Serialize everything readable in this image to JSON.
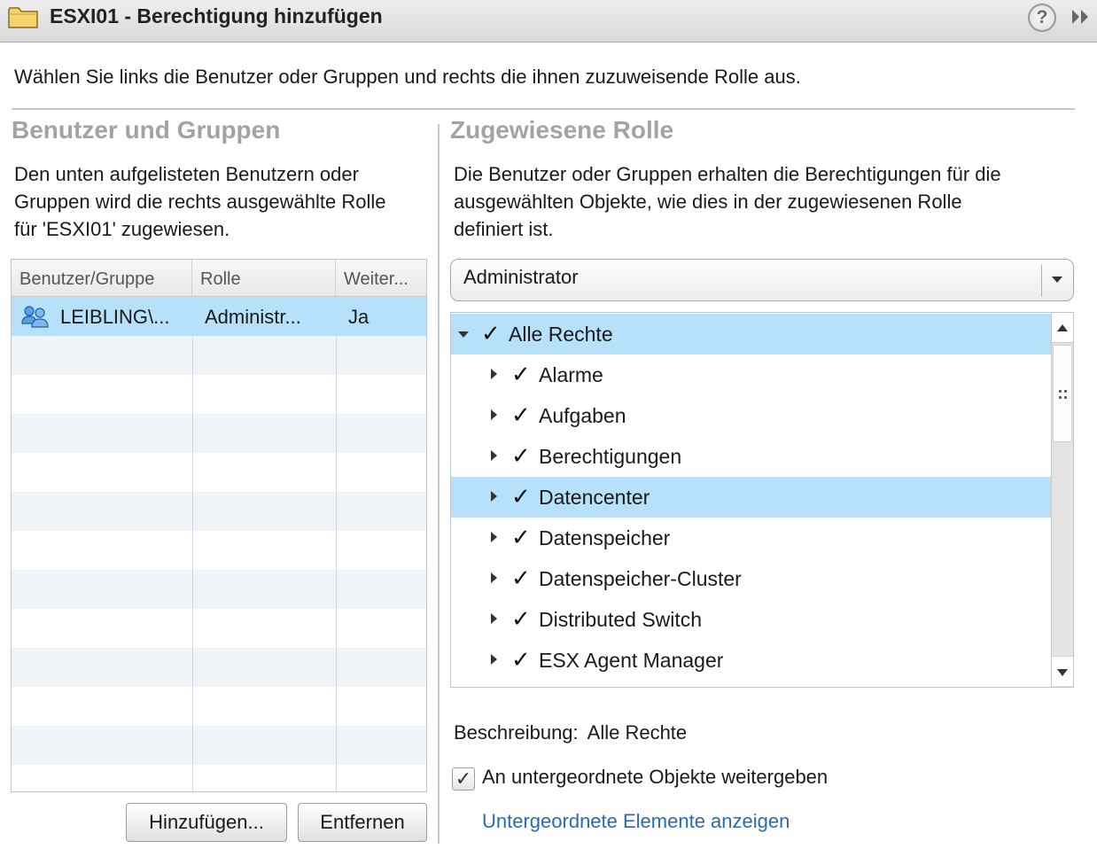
{
  "window": {
    "title": "ESXI01 - Berechtigung hinzufügen",
    "help_glyph": "?",
    "icons": [
      "folder-icon",
      "help-icon",
      "expand-icon"
    ]
  },
  "instruction": "Wählen Sie links die Benutzer oder Gruppen und rechts die ihnen zuzuweisende Rolle aus.",
  "left": {
    "heading": "Benutzer und Gruppen",
    "description_lines": [
      "Den unten aufgelisteten Benutzern oder",
      "Gruppen wird die rechts ausgewählte Rolle",
      "für 'ESXI01' zugewiesen."
    ],
    "table": {
      "columns": [
        "Benutzer/Gruppe",
        "Rolle",
        "Weiter..."
      ],
      "rows": [
        {
          "user": "LEIBLING\\...",
          "role": "Administr...",
          "propagate": "Ja",
          "icon": "group-icon"
        }
      ]
    },
    "buttons": {
      "add": "Hinzufügen...",
      "remove": "Entfernen"
    }
  },
  "right": {
    "heading": "Zugewiesene Rolle",
    "description_lines": [
      "Die Benutzer oder Gruppen erhalten die Berechtigungen für die",
      "ausgewählten Objekte, wie dies in der zugewiesenen Rolle",
      "definiert ist."
    ],
    "role_select": {
      "value": "Administrator"
    },
    "privileges": [
      {
        "label": "Alle Rechte",
        "level": 0,
        "expanded": true,
        "checked": true,
        "selected": true
      },
      {
        "label": "Alarme",
        "level": 1,
        "expanded": false,
        "checked": true,
        "selected": false
      },
      {
        "label": "Aufgaben",
        "level": 1,
        "expanded": false,
        "checked": true,
        "selected": false
      },
      {
        "label": "Berechtigungen",
        "level": 1,
        "expanded": false,
        "checked": true,
        "selected": false
      },
      {
        "label": "Datencenter",
        "level": 1,
        "expanded": false,
        "checked": true,
        "selected": true
      },
      {
        "label": "Datenspeicher",
        "level": 1,
        "expanded": false,
        "checked": true,
        "selected": false
      },
      {
        "label": "Datenspeicher-Cluster",
        "level": 1,
        "expanded": false,
        "checked": true,
        "selected": false
      },
      {
        "label": "Distributed Switch",
        "level": 1,
        "expanded": false,
        "checked": true,
        "selected": false
      },
      {
        "label": "ESX Agent Manager",
        "level": 1,
        "expanded": false,
        "checked": true,
        "selected": false
      }
    ],
    "check_glyph": "✓",
    "description_label": "Beschreibung:",
    "description_value": "Alle Rechte",
    "propagate": {
      "label": "An untergeordnete Objekte weitergeben",
      "checked": true,
      "glyph": "✓"
    },
    "child_link": "Untergeordnete Elemente anzeigen"
  },
  "colors": {
    "selection": "#b7e0fb",
    "link": "#2a6bb0",
    "heading": "#a3a3a3"
  }
}
